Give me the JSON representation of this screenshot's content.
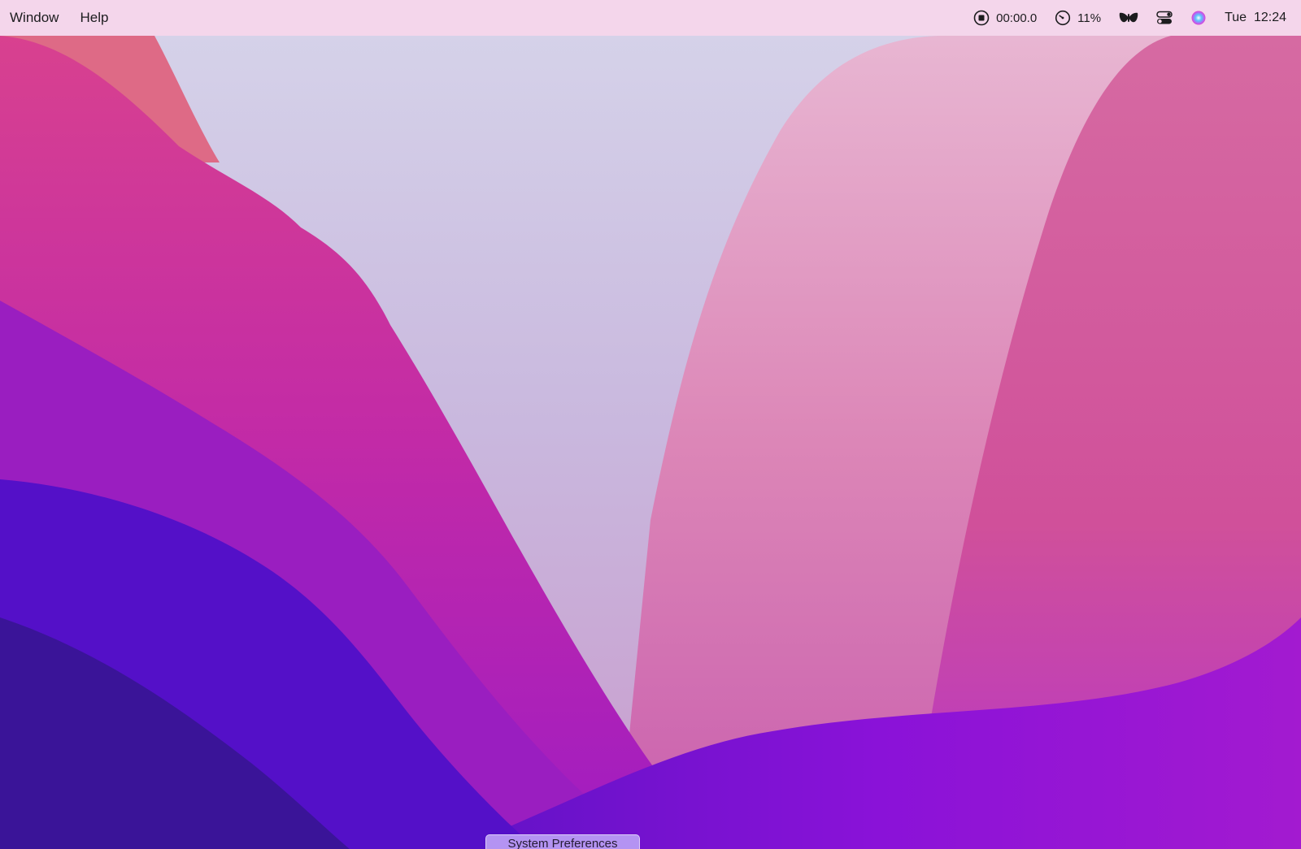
{
  "menubar": {
    "menus": [
      {
        "label": "Window"
      },
      {
        "label": "Help"
      }
    ],
    "status": {
      "recorder_icon": "record-stop-icon",
      "recorder_time": "00:00.0",
      "battery_icon": "gauge-icon",
      "battery_percent": "11%",
      "butterfly_icon": "butterfly-icon",
      "control_center_icon": "control-center-icon",
      "siri_icon": "siri-icon",
      "clock": "Tue  12:24"
    }
  },
  "dock": {
    "tooltip": "System Preferences"
  },
  "colors": {
    "menubar_bg": "#f6d6ea",
    "tooltip_bg": "#b493f2"
  }
}
